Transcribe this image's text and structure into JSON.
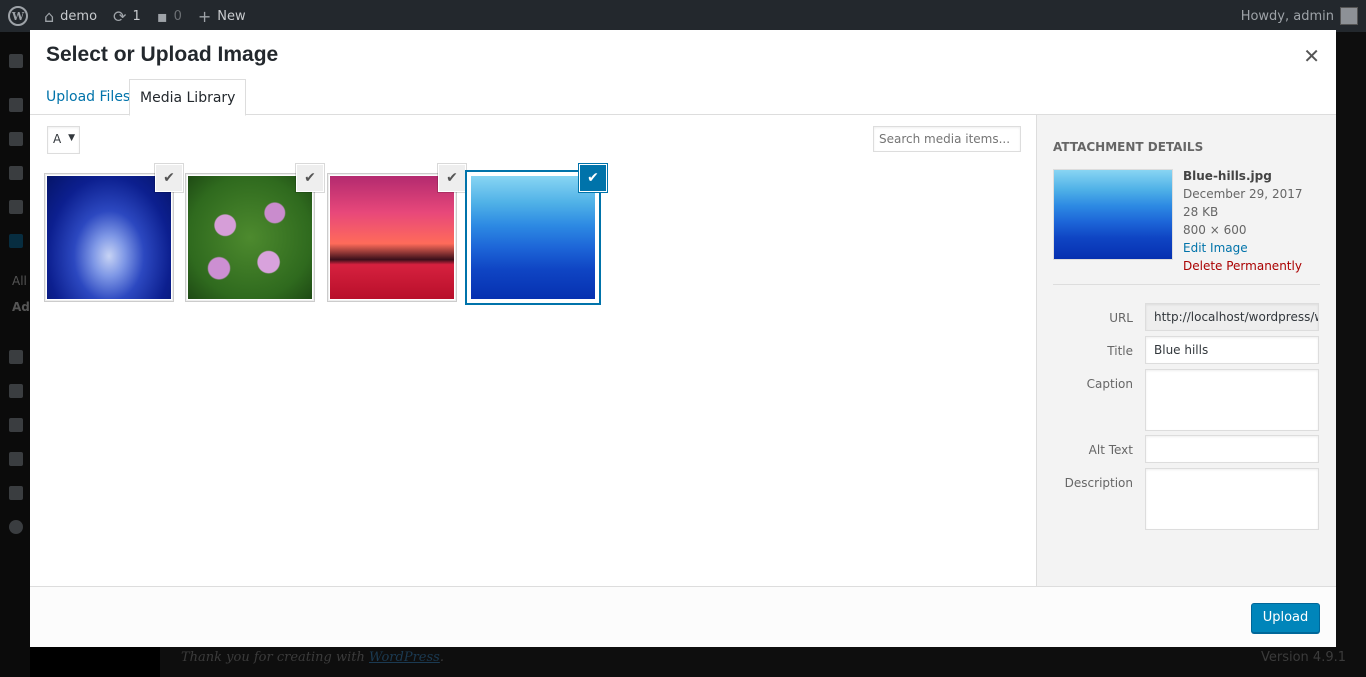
{
  "adminbar": {
    "site_name": "demo",
    "updates_count": "1",
    "comments_count": "0",
    "new_label": "New",
    "greeting": "Howdy, admin"
  },
  "sidebar_partial": [
    "All",
    "Ad"
  ],
  "footer": {
    "thanks_prefix": "Thank you for creating with ",
    "thanks_link": "WordPress",
    "thanks_suffix": ".",
    "version": "Version 4.9.1"
  },
  "modal": {
    "title": "Select or Upload Image",
    "close_icon": "close-icon",
    "tabs": [
      {
        "label": "Upload Files",
        "active": false
      },
      {
        "label": "Media Library",
        "active": true
      }
    ],
    "filter_value": "A",
    "search_placeholder": "Search media items...",
    "thumbnails": [
      {
        "image": "frosty-forest",
        "selected": false
      },
      {
        "image": "lotus-flowers",
        "selected": false
      },
      {
        "image": "sunset",
        "selected": false
      },
      {
        "image": "blue-hills",
        "selected": true
      }
    ],
    "attachment_details": {
      "heading": "Attachment Details",
      "filename": "Blue-hills.jpg",
      "date": "December 29, 2017",
      "size": "28 KB",
      "dimensions": "800 × 600",
      "edit_link": "Edit Image",
      "delete_link": "Delete Permanently",
      "fields": {
        "url_label": "URL",
        "url_value": "http://localhost/wordpress/w",
        "title_label": "Title",
        "title_value": "Blue hills",
        "caption_label": "Caption",
        "caption_value": "",
        "alt_label": "Alt Text",
        "alt_value": "",
        "description_label": "Description",
        "description_value": ""
      }
    },
    "upload_button": "Upload"
  },
  "colors": {
    "accent": "#0073aa",
    "button": "#0085ba",
    "danger": "#a00"
  }
}
